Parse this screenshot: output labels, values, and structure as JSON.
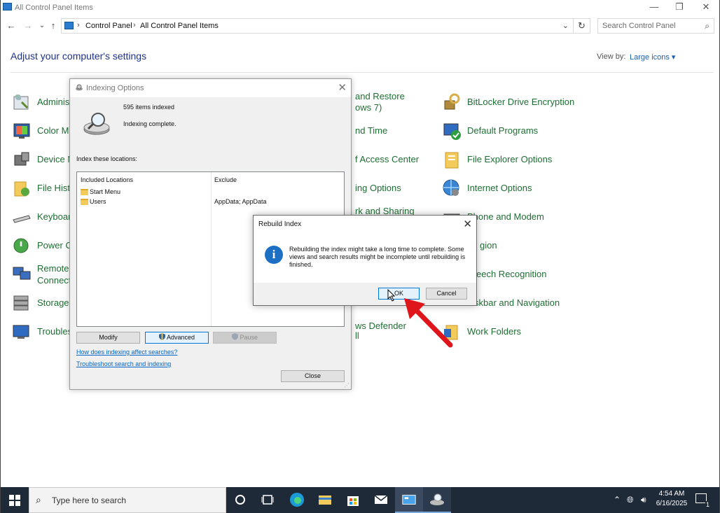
{
  "window": {
    "title": "All Control Panel Items",
    "minimize": "—",
    "restore": "❐",
    "close": "✕"
  },
  "nav": {
    "back": "←",
    "forward": "→",
    "recent": "⌄",
    "up": "↑",
    "breadcrumb": [
      "Control Panel",
      "All Control Panel Items"
    ],
    "refresh": "↻",
    "search_placeholder": "Search Control Panel"
  },
  "main": {
    "heading": "Adjust your computer's settings",
    "view_by_label": "View by:",
    "view_by_value": "Large icons ▾"
  },
  "items": {
    "col1": [
      "Adminis",
      "Color Ma",
      "Device M",
      "File Histo",
      "Keyboar",
      "Power O",
      "Remote",
      "Connect",
      "Storage",
      "Troubles"
    ],
    "col2": [
      "and Restore",
      "ows 7)",
      "nd Time",
      "f Access Center",
      "ing Options",
      "rk and Sharing",
      "gion",
      "eech Recognition",
      "skbar and Navigation",
      "ws Defender",
      "ll"
    ],
    "col3": [
      "BitLocker Drive Encryption",
      "Default Programs",
      "File Explorer Options",
      "Internet Options",
      "Phone and Modem",
      "Work Folders"
    ]
  },
  "indexing": {
    "title": "Indexing Options",
    "items_indexed": "595 items indexed",
    "status": "Indexing complete.",
    "locations_label": "Index these locations:",
    "col_included": "Included Locations",
    "col_exclude": "Exclude",
    "locations": [
      "Start Menu",
      "Users"
    ],
    "exclude_users": "AppData; AppData",
    "modify": "Modify",
    "advanced": "Advanced",
    "pause": "Pause",
    "link1": "How does indexing affect searches?",
    "link2": "Troubleshoot search and indexing",
    "close": "Close"
  },
  "rebuild": {
    "title": "Rebuild Index",
    "message": "Rebuilding the index might take a long time to complete. Some views and search results might be incomplete until rebuilding is finished.",
    "ok": "OK",
    "cancel": "Cancel"
  },
  "taskbar": {
    "search_placeholder": "Type here to search",
    "time": "4:54 AM",
    "date": "6/16/2025",
    "notification_count": "1"
  },
  "colors": {
    "accent": "#0078d7",
    "link_green": "#1e6e33",
    "taskbar": "#1f2a38",
    "arrow": "#e0141b"
  }
}
